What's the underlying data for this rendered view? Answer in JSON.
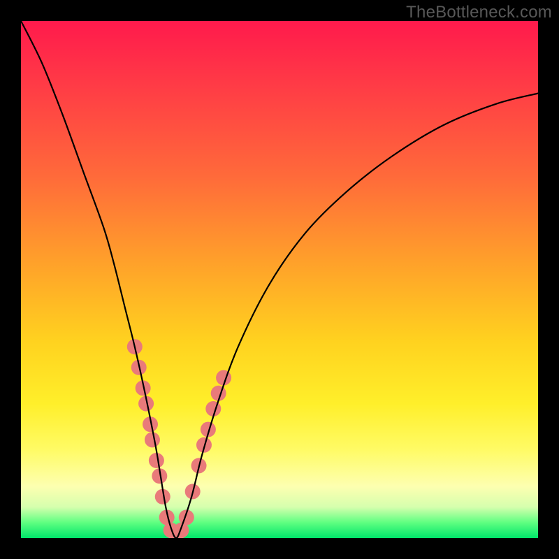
{
  "watermark": "TheBottleneck.com",
  "chart_data": {
    "type": "line",
    "title": "",
    "xlabel": "",
    "ylabel": "",
    "xlim": [
      0,
      100
    ],
    "ylim": [
      0,
      100
    ],
    "grid": false,
    "main_curve": {
      "name": "bottleneck-curve",
      "color": "#000000",
      "x": [
        0,
        4,
        8,
        12,
        16,
        18,
        20,
        22,
        24,
        26,
        27,
        28,
        29,
        30,
        31,
        33,
        35,
        38,
        42,
        48,
        55,
        63,
        72,
        82,
        92,
        100
      ],
      "y": [
        100,
        92,
        82,
        71,
        60,
        53,
        45,
        37,
        28,
        18,
        12,
        6,
        2,
        0,
        2,
        8,
        16,
        26,
        37,
        49,
        59,
        67,
        74,
        80,
        84,
        86
      ]
    },
    "dots": {
      "name": "highlight-dots",
      "color": "#e97a7a",
      "radius": 11,
      "points": [
        {
          "x": 22.0,
          "y": 37
        },
        {
          "x": 22.8,
          "y": 33
        },
        {
          "x": 23.6,
          "y": 29
        },
        {
          "x": 24.2,
          "y": 26
        },
        {
          "x": 25.0,
          "y": 22
        },
        {
          "x": 25.4,
          "y": 19
        },
        {
          "x": 26.2,
          "y": 15
        },
        {
          "x": 26.8,
          "y": 12
        },
        {
          "x": 27.4,
          "y": 8
        },
        {
          "x": 28.2,
          "y": 4
        },
        {
          "x": 29.0,
          "y": 1.5
        },
        {
          "x": 30.0,
          "y": 0.5
        },
        {
          "x": 31.0,
          "y": 1.5
        },
        {
          "x": 32.0,
          "y": 4
        },
        {
          "x": 33.2,
          "y": 9
        },
        {
          "x": 34.4,
          "y": 14
        },
        {
          "x": 35.4,
          "y": 18
        },
        {
          "x": 36.2,
          "y": 21
        },
        {
          "x": 37.2,
          "y": 25
        },
        {
          "x": 38.2,
          "y": 28
        },
        {
          "x": 39.2,
          "y": 31
        }
      ]
    },
    "gradient_stops": [
      {
        "pos": 0,
        "color": "#ff1a4c"
      },
      {
        "pos": 12,
        "color": "#ff3a46"
      },
      {
        "pos": 30,
        "color": "#ff6a3a"
      },
      {
        "pos": 48,
        "color": "#ffa529"
      },
      {
        "pos": 62,
        "color": "#ffd21f"
      },
      {
        "pos": 74,
        "color": "#ffef2a"
      },
      {
        "pos": 83,
        "color": "#fffb66"
      },
      {
        "pos": 90,
        "color": "#fdffb0"
      },
      {
        "pos": 94,
        "color": "#d6ffae"
      },
      {
        "pos": 97,
        "color": "#5fff81"
      },
      {
        "pos": 100,
        "color": "#00e56a"
      }
    ]
  }
}
